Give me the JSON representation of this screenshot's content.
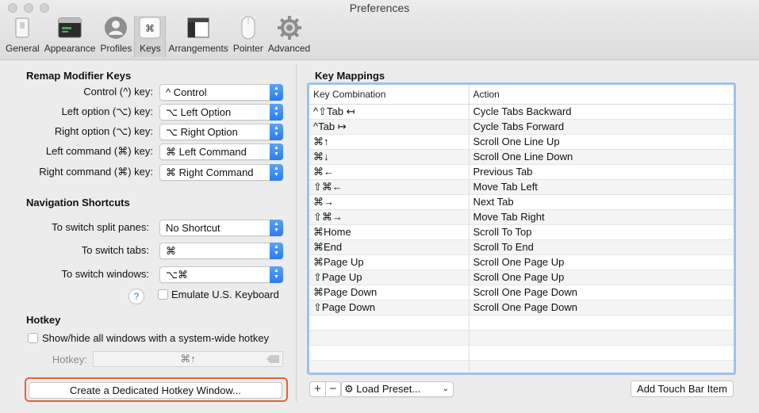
{
  "window": {
    "title": "Preferences"
  },
  "toolbar": {
    "tabs": [
      {
        "label": "General",
        "icon": "general-icon"
      },
      {
        "label": "Appearance",
        "icon": "appearance-icon"
      },
      {
        "label": "Profiles",
        "icon": "profiles-icon"
      },
      {
        "label": "Keys",
        "icon": "keys-icon",
        "active": true
      },
      {
        "label": "Arrangements",
        "icon": "arrangements-icon"
      },
      {
        "label": "Pointer",
        "icon": "pointer-icon"
      },
      {
        "label": "Advanced",
        "icon": "gear-icon"
      }
    ]
  },
  "remap": {
    "heading": "Remap Modifier Keys",
    "rows": [
      {
        "label": "Control (^) key:",
        "value": "^ Control"
      },
      {
        "label": "Left option (⌥) key:",
        "value": "⌥ Left Option"
      },
      {
        "label": "Right option (⌥) key:",
        "value": "⌥ Right Option"
      },
      {
        "label": "Left command (⌘) key:",
        "value": "⌘ Left Command"
      },
      {
        "label": "Right command (⌘) key:",
        "value": "⌘ Right Command"
      }
    ]
  },
  "nav": {
    "heading": "Navigation Shortcuts",
    "rows": [
      {
        "label": "To switch split panes:",
        "value": "No Shortcut"
      },
      {
        "label": "To switch tabs:",
        "value": "⌘"
      },
      {
        "label": "To switch windows:",
        "value": "⌥⌘"
      }
    ],
    "help": "?",
    "emulate_label": "Emulate U.S. Keyboard"
  },
  "hotkey": {
    "heading": "Hotkey",
    "showhide_label": "Show/hide all windows with a system-wide hotkey",
    "field_label": "Hotkey:",
    "field_value": "⌘↑",
    "create_button": "Create a Dedicated Hotkey Window..."
  },
  "mappings": {
    "heading": "Key Mappings",
    "columns": [
      "Key Combination",
      "Action"
    ],
    "rows": [
      [
        "^⇧Tab ↤",
        "Cycle Tabs Backward"
      ],
      [
        "^Tab ↦",
        "Cycle Tabs Forward"
      ],
      [
        "⌘↑",
        "Scroll One Line Up"
      ],
      [
        "⌘↓",
        "Scroll One Line Down"
      ],
      [
        "⌘←",
        "Previous Tab"
      ],
      [
        "⇧⌘←",
        "Move Tab Left"
      ],
      [
        "⌘→",
        "Next Tab"
      ],
      [
        "⇧⌘→",
        "Move Tab Right"
      ],
      [
        "⌘Home",
        "Scroll To Top"
      ],
      [
        "⌘End",
        "Scroll To End"
      ],
      [
        "⌘Page Up",
        "Scroll One Page Up"
      ],
      [
        "⇧Page Up",
        "Scroll One Page Up"
      ],
      [
        "⌘Page Down",
        "Scroll One Page Down"
      ],
      [
        "⇧Page Down",
        "Scroll One Page Down"
      ]
    ],
    "add": "+",
    "remove": "−",
    "preset_label": "Load Preset...",
    "touchbar_button": "Add Touch Bar Item"
  }
}
